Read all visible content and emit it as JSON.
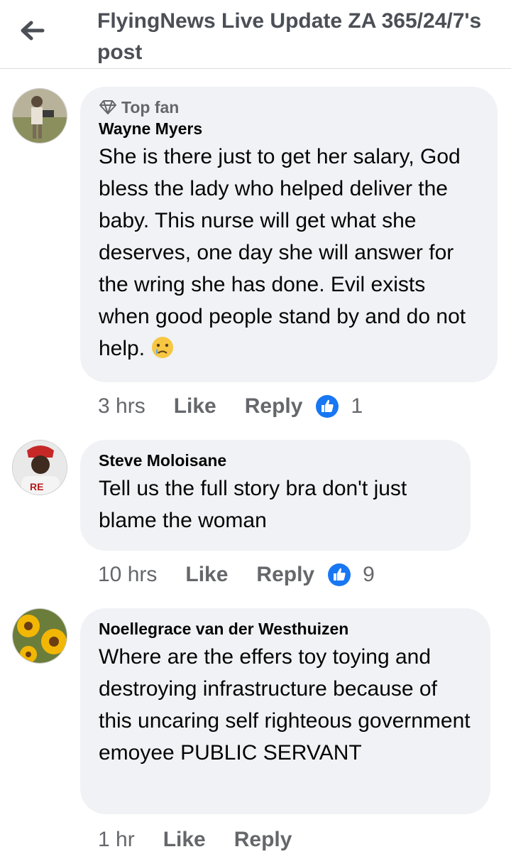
{
  "header": {
    "title": "FlyingNews Live Update ZA 365/24/7's post"
  },
  "comments": [
    {
      "badge": "Top fan",
      "author": "Wayne Myers",
      "text": "She is there just to get her salary, God bless the lady who helped deliver the baby. This nurse will get what she deserves, one day she will answer for the wring she has done. Evil exists when good people stand by and do not help.",
      "emoji": "crying-face",
      "time": "3 hrs",
      "like_label": "Like",
      "reply_label": "Reply",
      "reaction_count": "1"
    },
    {
      "author": "Steve Moloisane",
      "text": "Tell us the full story bra don't just blame the woman",
      "time": "10 hrs",
      "like_label": "Like",
      "reply_label": "Reply",
      "reaction_count": "9"
    },
    {
      "author": "Noellegrace van der Westhuizen",
      "text": "Where are the effers toy toying and destroying infrastructure because of this uncaring self righteous government emoyee PUBLIC SERVANT",
      "time": "1 hr",
      "like_label": "Like",
      "reply_label": "Reply"
    }
  ],
  "colors": {
    "like_blue": "#1877f2",
    "bubble": "#f0f2f5",
    "muted": "#65676b"
  }
}
